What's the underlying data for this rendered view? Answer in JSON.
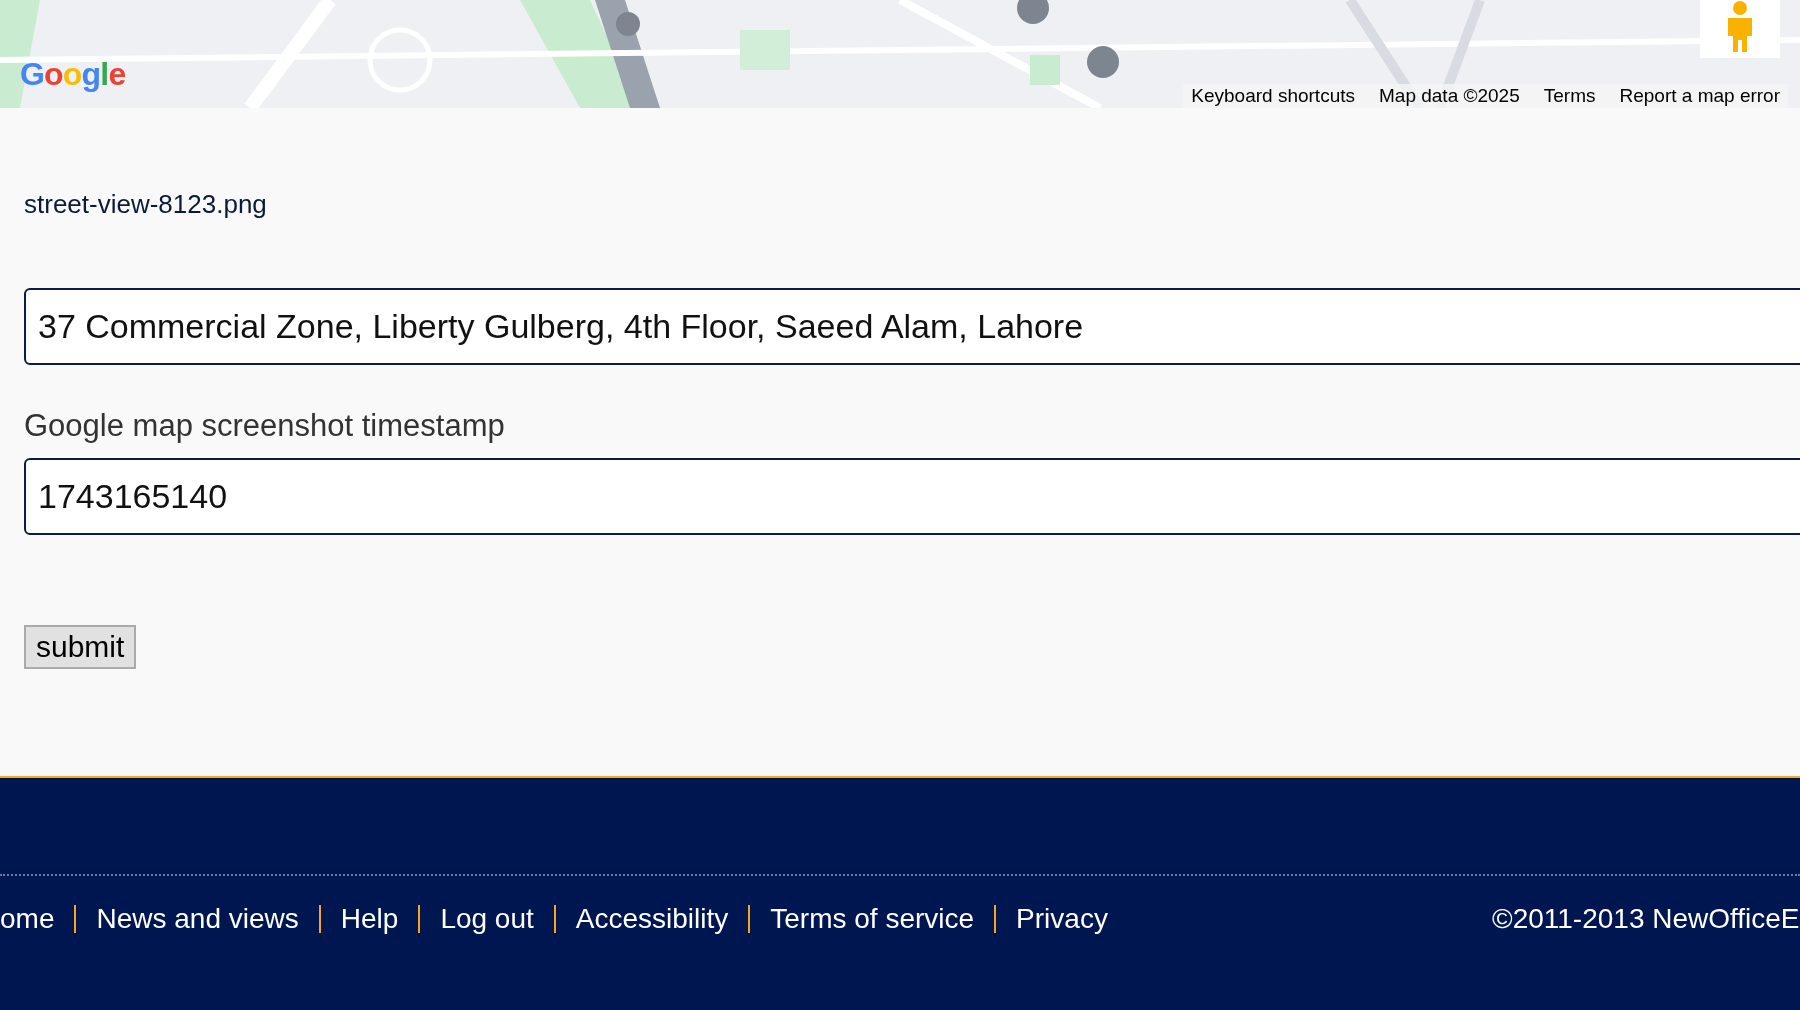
{
  "map": {
    "kind": "picture",
    "logo": [
      "G",
      "o",
      "o",
      "g",
      "l",
      "e"
    ],
    "attribution": [
      "Keyboard shortcuts",
      "Map data ©2025",
      "Terms",
      "Report a map error"
    ]
  },
  "form": {
    "file_name": "street-view-8123.png",
    "fields": [
      {
        "value": "37 Commercial Zone, Liberty Gulberg, 4th Floor, Saeed Alam, Lahore"
      },
      {
        "label": "Google map screenshot timestamp",
        "value": "1743165140"
      }
    ],
    "submit": "submit"
  },
  "footer": {
    "links": [
      "ome",
      "News and views",
      "Help",
      "Log out",
      "Accessibility",
      "Terms of service",
      "Privacy"
    ],
    "copyright": "©2011-2013 NewOfficeE"
  }
}
